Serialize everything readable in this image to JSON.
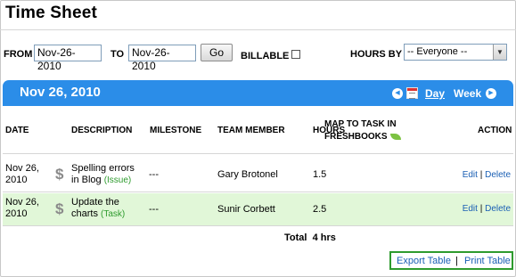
{
  "page": {
    "title": "Time Sheet"
  },
  "filters": {
    "from_label": "FROM",
    "from_value": "Nov-26-2010",
    "to_label": "TO",
    "to_value": "Nov-26-2010",
    "go_label": "Go",
    "billable_label": "BILLABLE",
    "billable_checked": false,
    "hours_by_label": "HOURS BY",
    "hours_by_value": "-- Everyone --"
  },
  "date_bar": {
    "date": "Nov 26, 2010",
    "prev_icon": "left-arrow-icon",
    "next_icon": "right-arrow-icon",
    "calendar_icon": "calendar-icon",
    "day_label": "Day",
    "week_label": "Week",
    "color": "#2b8de8"
  },
  "table": {
    "headers": {
      "date": "DATE",
      "description": "DESCRIPTION",
      "milestone": "MILESTONE",
      "team_member": "TEAM MEMBER",
      "hours": "HOURS",
      "map_task_line1": "MAP TO TASK IN",
      "map_task_line2": "FRESHBOOKS",
      "action": "ACTION"
    },
    "rows": [
      {
        "date_line1": "Nov 26,",
        "date_line2": "2010",
        "billable_icon": "dollar-icon",
        "desc_line1": "Spelling errors",
        "desc_line2": "in Blog",
        "type": "(Issue)",
        "milestone": "---",
        "member": "Gary Brotonel",
        "hours": "1.5",
        "edit_label": "Edit",
        "separator": "|",
        "delete_label": "Delete"
      },
      {
        "date_line1": "Nov 26,",
        "date_line2": "2010",
        "billable_icon": "dollar-icon",
        "desc_line1": "Update the",
        "desc_line2": "charts",
        "type": "(Task)",
        "milestone": "---",
        "member": "Sunir Corbett",
        "hours": "2.5",
        "edit_label": "Edit",
        "separator": "|",
        "delete_label": "Delete"
      }
    ],
    "total_label": "Total",
    "total_value": "4 hrs"
  },
  "footer": {
    "export_label": "Export Table",
    "separator": "|",
    "print_label": "Print Table"
  },
  "colors": {
    "accent": "#2b8de8",
    "highlight_row": "#e1f7d8",
    "link": "#1a5fb4",
    "tag": "#2e9b2e"
  }
}
